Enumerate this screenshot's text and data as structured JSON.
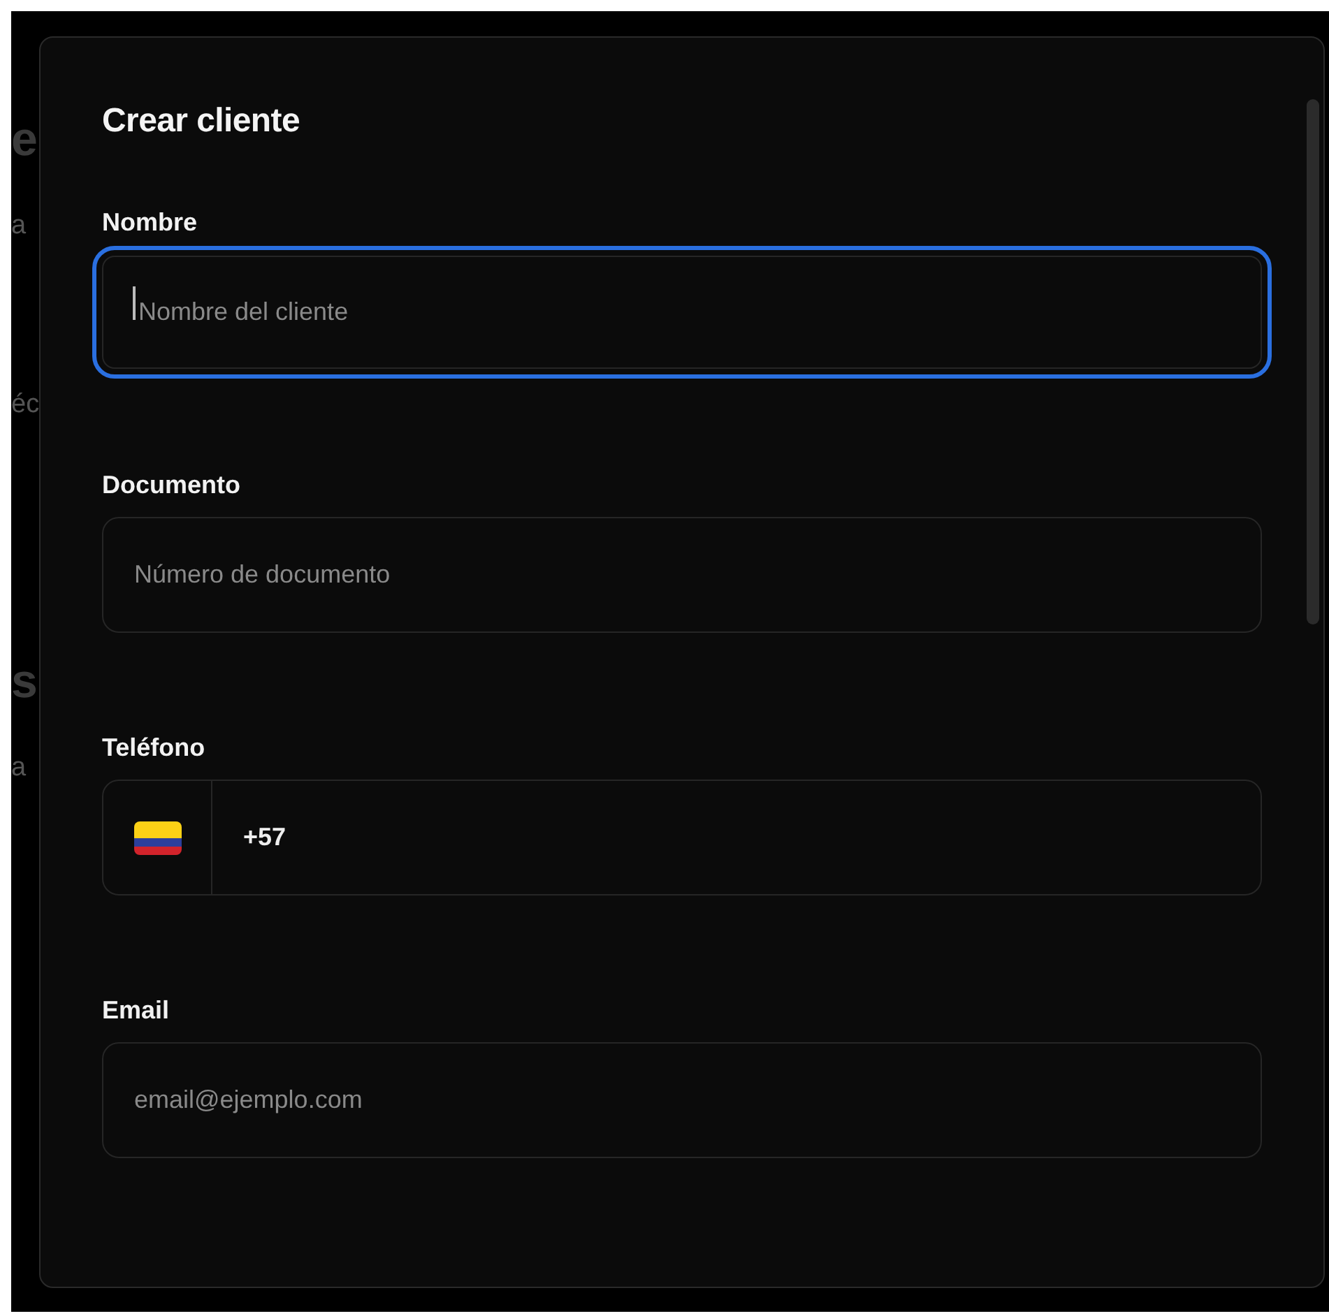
{
  "background": {
    "fragments": [
      {
        "text": "e",
        "kind": "heading"
      },
      {
        "text": "a",
        "kind": "line"
      },
      {
        "text": "éc",
        "kind": "line"
      },
      {
        "text": "s",
        "kind": "heading"
      },
      {
        "text": "a",
        "kind": "line"
      }
    ]
  },
  "dialog": {
    "title": "Crear cliente",
    "fields": [
      {
        "label": "Nombre",
        "kind": "text",
        "placeholder": "Nombre del cliente",
        "focused": true
      },
      {
        "label": "Documento",
        "kind": "text",
        "placeholder": "Número de documento",
        "focused": false
      },
      {
        "label": "Teléfono",
        "kind": "phone",
        "value": "+57",
        "focused": false
      },
      {
        "label": "Email",
        "kind": "text",
        "placeholder": "email@ejemplo.com",
        "focused": false
      }
    ]
  }
}
